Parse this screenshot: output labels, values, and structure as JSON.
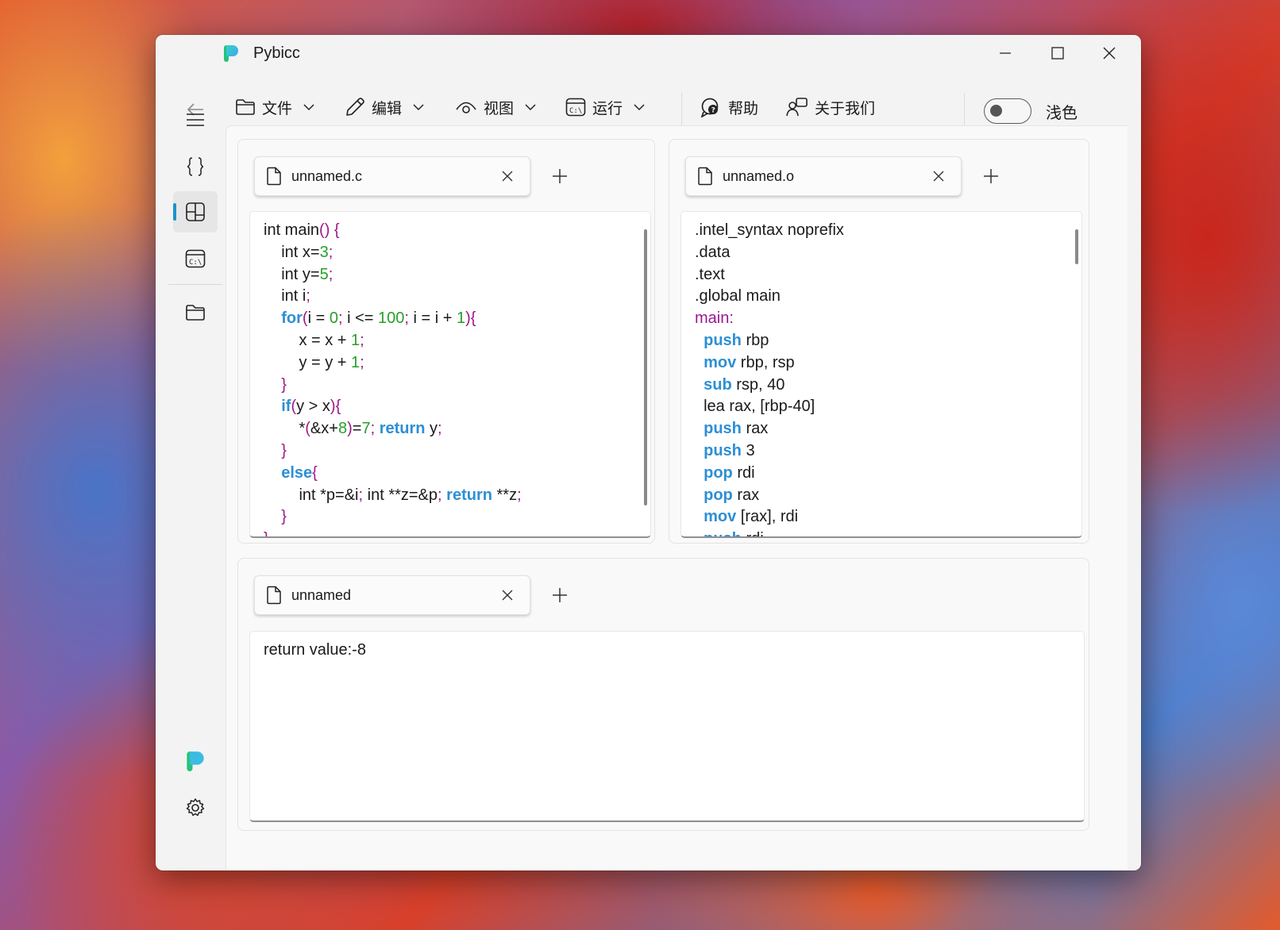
{
  "app": {
    "title": "Pybicc"
  },
  "toolbar": {
    "file": "文件",
    "edit": "编辑",
    "view": "视图",
    "run": "运行",
    "help": "帮助",
    "about": "关于我们",
    "theme_label": "浅色",
    "theme_toggle_on": false
  },
  "tabs": {
    "source": {
      "name": "unnamed.c"
    },
    "asm": {
      "name": "unnamed.o"
    },
    "output": {
      "name": "unnamed"
    }
  },
  "source_code": [
    [
      [
        "t",
        "int main"
      ],
      [
        "p",
        "() {"
      ]
    ],
    [
      [
        "t",
        "    int x="
      ],
      [
        "n",
        "3"
      ],
      [
        "p",
        ";"
      ]
    ],
    [
      [
        "t",
        "    int y="
      ],
      [
        "n",
        "5"
      ],
      [
        "p",
        ";"
      ]
    ],
    [
      [
        "t",
        "    int i"
      ],
      [
        "p",
        ";"
      ]
    ],
    [
      [
        "t",
        "    "
      ],
      [
        "k",
        "for"
      ],
      [
        "p",
        "("
      ],
      [
        "t",
        "i = "
      ],
      [
        "n",
        "0"
      ],
      [
        "p",
        ";"
      ],
      [
        "t",
        " i <= "
      ],
      [
        "n",
        "100"
      ],
      [
        "p",
        ";"
      ],
      [
        "t",
        " i = i + "
      ],
      [
        "n",
        "1"
      ],
      [
        "p",
        "){"
      ]
    ],
    [
      [
        "t",
        "        x = x + "
      ],
      [
        "n",
        "1"
      ],
      [
        "p",
        ";"
      ]
    ],
    [
      [
        "t",
        "        y = y + "
      ],
      [
        "n",
        "1"
      ],
      [
        "p",
        ";"
      ]
    ],
    [
      [
        "t",
        "    "
      ],
      [
        "p",
        "}"
      ]
    ],
    [
      [
        "t",
        "    "
      ],
      [
        "k",
        "if"
      ],
      [
        "p",
        "("
      ],
      [
        "t",
        "y > x"
      ],
      [
        "p",
        "){"
      ]
    ],
    [
      [
        "t",
        "        *"
      ],
      [
        "p",
        "("
      ],
      [
        "t",
        "&x+"
      ],
      [
        "n",
        "8"
      ],
      [
        "p",
        ")"
      ],
      [
        "t",
        "="
      ],
      [
        "n",
        "7"
      ],
      [
        "p",
        ";"
      ],
      [
        "t",
        " "
      ],
      [
        "k",
        "return"
      ],
      [
        "t",
        " y"
      ],
      [
        "p",
        ";"
      ]
    ],
    [
      [
        "t",
        "    "
      ],
      [
        "p",
        "}"
      ]
    ],
    [
      [
        "t",
        "    "
      ],
      [
        "k",
        "else"
      ],
      [
        "p",
        "{"
      ]
    ],
    [
      [
        "t",
        "        int *p=&i"
      ],
      [
        "p",
        ";"
      ],
      [
        "t",
        " int **z=&p"
      ],
      [
        "p",
        ";"
      ],
      [
        "t",
        " "
      ],
      [
        "k",
        "return"
      ],
      [
        "t",
        " **z"
      ],
      [
        "p",
        ";"
      ]
    ],
    [
      [
        "t",
        "    "
      ],
      [
        "p",
        "}"
      ]
    ],
    [
      [
        "p",
        "}"
      ]
    ]
  ],
  "asm_code": [
    [
      [
        "t",
        ".intel_syntax noprefix"
      ]
    ],
    [
      [
        "t",
        ".data"
      ]
    ],
    [
      [
        "t",
        ".text"
      ]
    ],
    [
      [
        "t",
        ".global main"
      ]
    ],
    [
      [
        "l",
        "main:"
      ]
    ],
    [
      [
        "t",
        "  "
      ],
      [
        "k",
        "push"
      ],
      [
        "t",
        " rbp"
      ]
    ],
    [
      [
        "t",
        "  "
      ],
      [
        "k",
        "mov"
      ],
      [
        "t",
        " rbp, rsp"
      ]
    ],
    [
      [
        "t",
        "  "
      ],
      [
        "k",
        "sub"
      ],
      [
        "t",
        " rsp, 40"
      ]
    ],
    [
      [
        "t",
        "  lea rax, [rbp-40]"
      ]
    ],
    [
      [
        "t",
        "  "
      ],
      [
        "k",
        "push"
      ],
      [
        "t",
        " rax"
      ]
    ],
    [
      [
        "t",
        "  "
      ],
      [
        "k",
        "push"
      ],
      [
        "t",
        " 3"
      ]
    ],
    [
      [
        "t",
        "  "
      ],
      [
        "k",
        "pop"
      ],
      [
        "t",
        " rdi"
      ]
    ],
    [
      [
        "t",
        "  "
      ],
      [
        "k",
        "pop"
      ],
      [
        "t",
        " rax"
      ]
    ],
    [
      [
        "t",
        "  "
      ],
      [
        "k",
        "mov"
      ],
      [
        "t",
        " [rax], rdi"
      ]
    ],
    [
      [
        "t",
        "  "
      ],
      [
        "k",
        "push"
      ],
      [
        "t",
        " rdi"
      ]
    ]
  ],
  "output": {
    "text": "return value:-8"
  },
  "colors": {
    "accent": "#1f93c9",
    "keyword": "#2d8fd5",
    "number": "#26a02a",
    "punct": "#a0178a"
  }
}
